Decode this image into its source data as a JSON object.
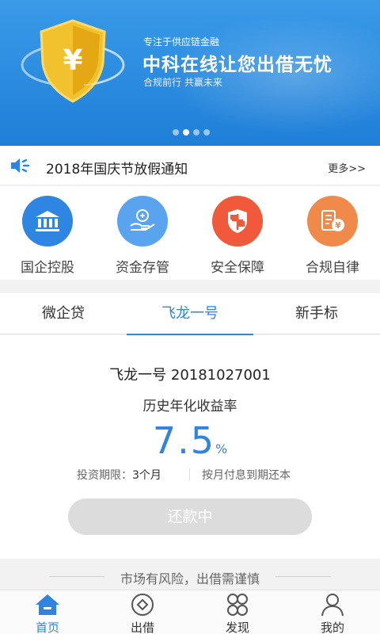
{
  "banner": {
    "tagline": "专注于供应链金融",
    "title": "中科在线让您出借无忧",
    "subtitle": "合规前行 共赢未来",
    "logo_symbol": "¥",
    "slides": 4,
    "active_slide": 2
  },
  "notice": {
    "text": "2018年国庆节放假通知",
    "more": "更多>>"
  },
  "features": [
    {
      "label": "国企控股",
      "icon": "bank-icon",
      "color": "#2f86e2"
    },
    {
      "label": "资金存管",
      "icon": "hand-coin-icon",
      "color": "#55a0ee"
    },
    {
      "label": "安全保障",
      "icon": "shield-icon",
      "color": "#f05a3a"
    },
    {
      "label": "合规自律",
      "icon": "document-coin-icon",
      "color": "#f08a4a"
    }
  ],
  "tabs": [
    {
      "label": "微企贷",
      "active": false
    },
    {
      "label": "飞龙一号",
      "active": true
    },
    {
      "label": "新手标",
      "active": false
    }
  ],
  "product": {
    "name": "飞龙一号 20181027001",
    "rate_label": "历史年化收益率",
    "rate_value": "7.5",
    "rate_unit": "%",
    "term_label": "投资期限：",
    "term_value": "3个月",
    "repayment": "按月付息到期还本",
    "button": "还款中"
  },
  "risk_notice": "市场有风险，出借需谨慎",
  "bottom_nav": [
    {
      "label": "首页",
      "icon": "home-icon",
      "active": true
    },
    {
      "label": "出借",
      "icon": "lend-icon",
      "active": false
    },
    {
      "label": "发现",
      "icon": "discover-grid-icon",
      "active": false
    },
    {
      "label": "我的",
      "icon": "user-icon",
      "active": false
    }
  ],
  "colors": {
    "accent": "#2f84e0",
    "banner": "#2a8be0",
    "disabled_button": "#dcdcdc"
  }
}
